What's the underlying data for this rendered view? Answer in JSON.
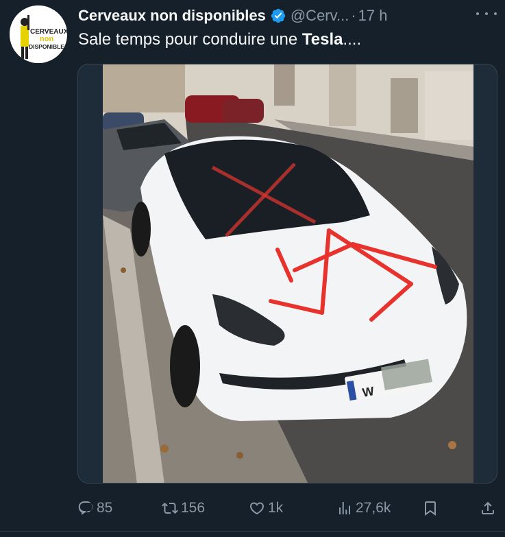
{
  "tweet": {
    "display_name": "Cerveaux non disponibles",
    "handle": "@Cerv...",
    "separator": "·",
    "time": "17 h",
    "text_plain": "Sale temps pour conduire une ",
    "text_bold": "Tesla",
    "text_tail": "....",
    "avatar_logo_text": [
      "CERVEAUX",
      "non",
      "DISPONIBLES"
    ]
  },
  "photo": {
    "plate_prefix": "W"
  },
  "actions": {
    "replies": "85",
    "reposts": "156",
    "likes": "1k",
    "views": "27,6k"
  },
  "icons": {
    "verified": "verified-badge-icon",
    "more": "more-icon",
    "reply": "reply-icon",
    "repost": "repost-icon",
    "like": "heart-icon",
    "views": "views-icon",
    "bookmark": "bookmark-icon",
    "share": "share-icon"
  },
  "colors": {
    "background": "#15202b",
    "text": "#f7f9f9",
    "muted": "#8b98a5",
    "verified": "#1d9bf0",
    "paint": "#e8322d"
  }
}
